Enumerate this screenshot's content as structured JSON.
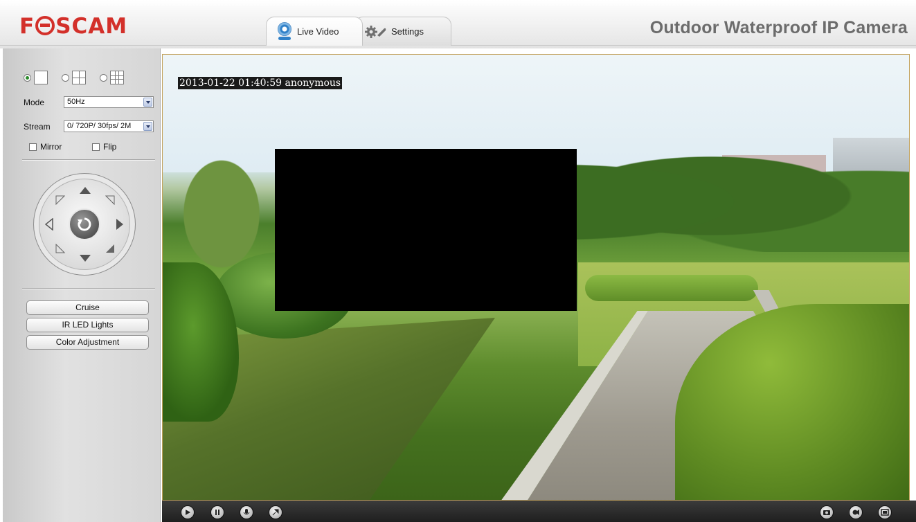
{
  "brand": {
    "logo": "FOSCAM",
    "accent": "#d3302a"
  },
  "product_title": "Outdoor Waterproof IP Camera",
  "tabs": [
    {
      "label": "Live Video",
      "icon": "camera-icon",
      "active": true
    },
    {
      "label": "Settings",
      "icon": "gears-icon",
      "active": false
    }
  ],
  "sidebar": {
    "view_modes": [
      {
        "name": "single-view",
        "selected": true
      },
      {
        "name": "four-view",
        "selected": false
      },
      {
        "name": "nine-view",
        "selected": false
      }
    ],
    "mode_label": "Mode",
    "mode_value": "50Hz",
    "stream_label": "Stream",
    "stream_value": "0/ 720P/ 30fps/ 2M",
    "mirror_label": "Mirror",
    "flip_label": "Flip",
    "buttons": [
      "Cruise",
      "IR LED Lights",
      "Color Adjustment"
    ]
  },
  "video": {
    "osd_text": "2013-01-22 01:40:59 anonymous"
  },
  "toolbar": {
    "left_icons": [
      "play-icon",
      "stop-icon",
      "audio-icon",
      "talk-icon"
    ],
    "right_icons": [
      "snapshot-icon",
      "record-icon",
      "fullscreen-icon"
    ]
  }
}
